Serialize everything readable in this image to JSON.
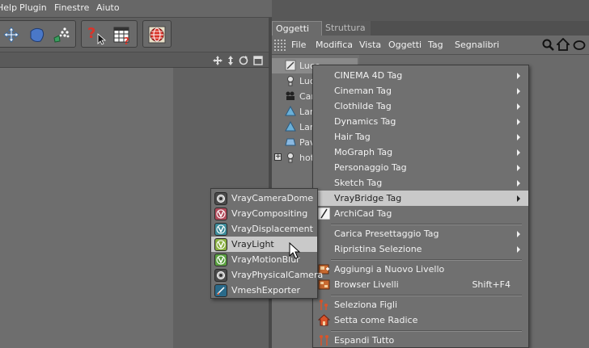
{
  "menubar": {
    "items": [
      "Help",
      "Plugin",
      "Finestre",
      "Aiuto"
    ]
  },
  "object_manager": {
    "tabs": [
      "Oggetti",
      "Struttura"
    ],
    "menu": [
      "File",
      "Modifica",
      "Vista",
      "Oggetti",
      "Tag",
      "Segnalibri"
    ],
    "objects": [
      "Luce",
      "Luce",
      "Came",
      "Lamp",
      "Lamp",
      "Pavi",
      "hotel"
    ]
  },
  "context_menu": {
    "items": [
      {
        "label": "CINEMA 4D Tag",
        "submenu": true
      },
      {
        "label": "Cineman Tag",
        "submenu": true
      },
      {
        "label": "Clothilde Tag",
        "submenu": true
      },
      {
        "label": "Dynamics Tag",
        "submenu": true
      },
      {
        "label": "Hair Tag",
        "submenu": true
      },
      {
        "label": "MoGraph Tag",
        "submenu": true
      },
      {
        "label": "Personaggio Tag",
        "submenu": true
      },
      {
        "label": "Sketch Tag",
        "submenu": true
      },
      {
        "label": "VrayBridge Tag",
        "submenu": true,
        "highlighted": true
      },
      {
        "label": "ArchiCad Tag",
        "submenu": false
      },
      {
        "label": "Carica Presettaggio Tag",
        "submenu": true
      },
      {
        "label": "Ripristina Selezione",
        "submenu": true
      },
      {
        "label": "Aggiungi a Nuovo Livello",
        "submenu": false
      },
      {
        "label": "Browser Livelli",
        "shortcut": "Shift+F4"
      },
      {
        "label": "Seleziona Figli",
        "submenu": false
      },
      {
        "label": "Setta come Radice",
        "submenu": false
      },
      {
        "label": "Espandi Tutto",
        "submenu": false
      }
    ]
  },
  "vray_submenu": {
    "items": [
      {
        "label": "VrayCameraDome",
        "color": "#4a4a4a"
      },
      {
        "label": "VrayCompositing",
        "color": "#b04a5a"
      },
      {
        "label": "VrayDisplacement",
        "color": "#3c8c9a"
      },
      {
        "label": "VrayLight",
        "color": "#8ab040",
        "highlighted": true
      },
      {
        "label": "VrayMotionBlur",
        "color": "#5aa040"
      },
      {
        "label": "VrayPhysicalCamera",
        "color": "#4a4a4a"
      },
      {
        "label": "VmeshExporter",
        "color": "#2a6a8a"
      }
    ]
  }
}
